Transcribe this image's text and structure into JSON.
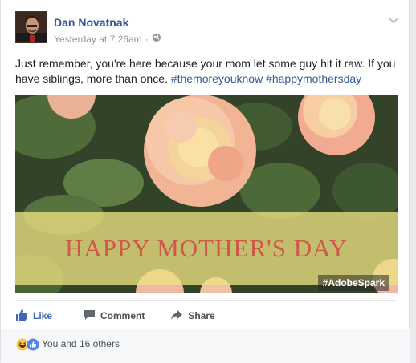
{
  "post": {
    "author": "Dan Novatnak",
    "timestamp": "Yesterday at 7:26am",
    "separator": "·",
    "privacy_icon": "globe-icon",
    "options_icon": "chevron-down-icon",
    "text": "Just remember, you're here because your mom let some guy hit it raw. If you have siblings, more than once.",
    "hashtags": [
      "#themoreyouknow",
      "#happymothersday"
    ],
    "image": {
      "banner_text": "HAPPY MOTHER'S DAY",
      "watermark": "#AdobeSpark",
      "banner_color": "#ece082",
      "banner_text_color": "#d0584a"
    }
  },
  "actions": {
    "like": "Like",
    "comment": "Comment",
    "share": "Share"
  },
  "reactions": {
    "icons": [
      "haha-icon",
      "like-icon"
    ],
    "summary": "You and 16 others"
  },
  "colors": {
    "link": "#365899",
    "like_blue": "#4267b2",
    "muted": "#90949c"
  }
}
